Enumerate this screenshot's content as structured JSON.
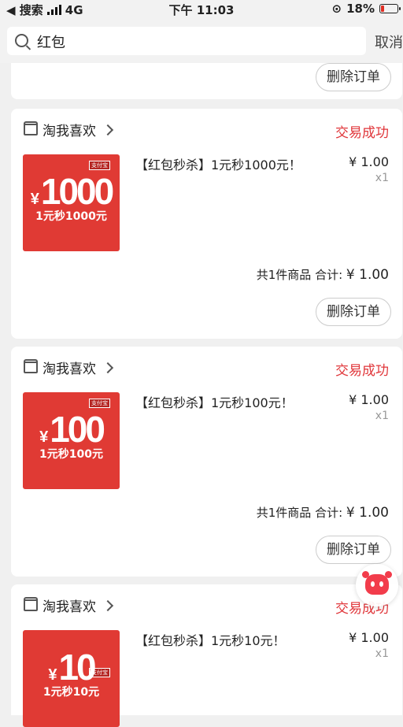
{
  "status_bar": {
    "back_app": "◀ 搜索",
    "network": "4G",
    "time": "下午 11:03",
    "battery": "18%",
    "battery_level": 0.18
  },
  "search": {
    "query": "红包",
    "cancel_label": "取消"
  },
  "delete_label": "删除订单",
  "orders": [
    {
      "shop": "淘我喜欢",
      "status": "交易成功",
      "title": "【红包秒杀】1元秒1000元！",
      "price": "¥ 1.00",
      "qty": "x1",
      "thumb_amount": "1000",
      "thumb_sub": "1元秒1000元",
      "thumb_tag": "支付宝",
      "total_count": "共1件商品",
      "total_label": "合计:",
      "total_value": "¥ 1.00"
    },
    {
      "shop": "淘我喜欢",
      "status": "交易成功",
      "title": "【红包秒杀】1元秒100元！",
      "price": "¥ 1.00",
      "qty": "x1",
      "thumb_amount": "100",
      "thumb_sub": "1元秒100元",
      "thumb_tag": "支付宝",
      "total_count": "共1件商品",
      "total_label": "合计:",
      "total_value": "¥ 1.00"
    },
    {
      "shop": "淘我喜欢",
      "status": "交易成功",
      "title": "【红包秒杀】1元秒10元！",
      "price": "¥ 1.00",
      "qty": "x1",
      "thumb_amount": "10",
      "thumb_sub": "1元秒10元",
      "thumb_tag": "支付宝"
    }
  ],
  "yen": "¥",
  "colors": {
    "accent": "#e0363a",
    "thumb_bg": "#e03a34",
    "page_bg": "#f0f0f0"
  }
}
